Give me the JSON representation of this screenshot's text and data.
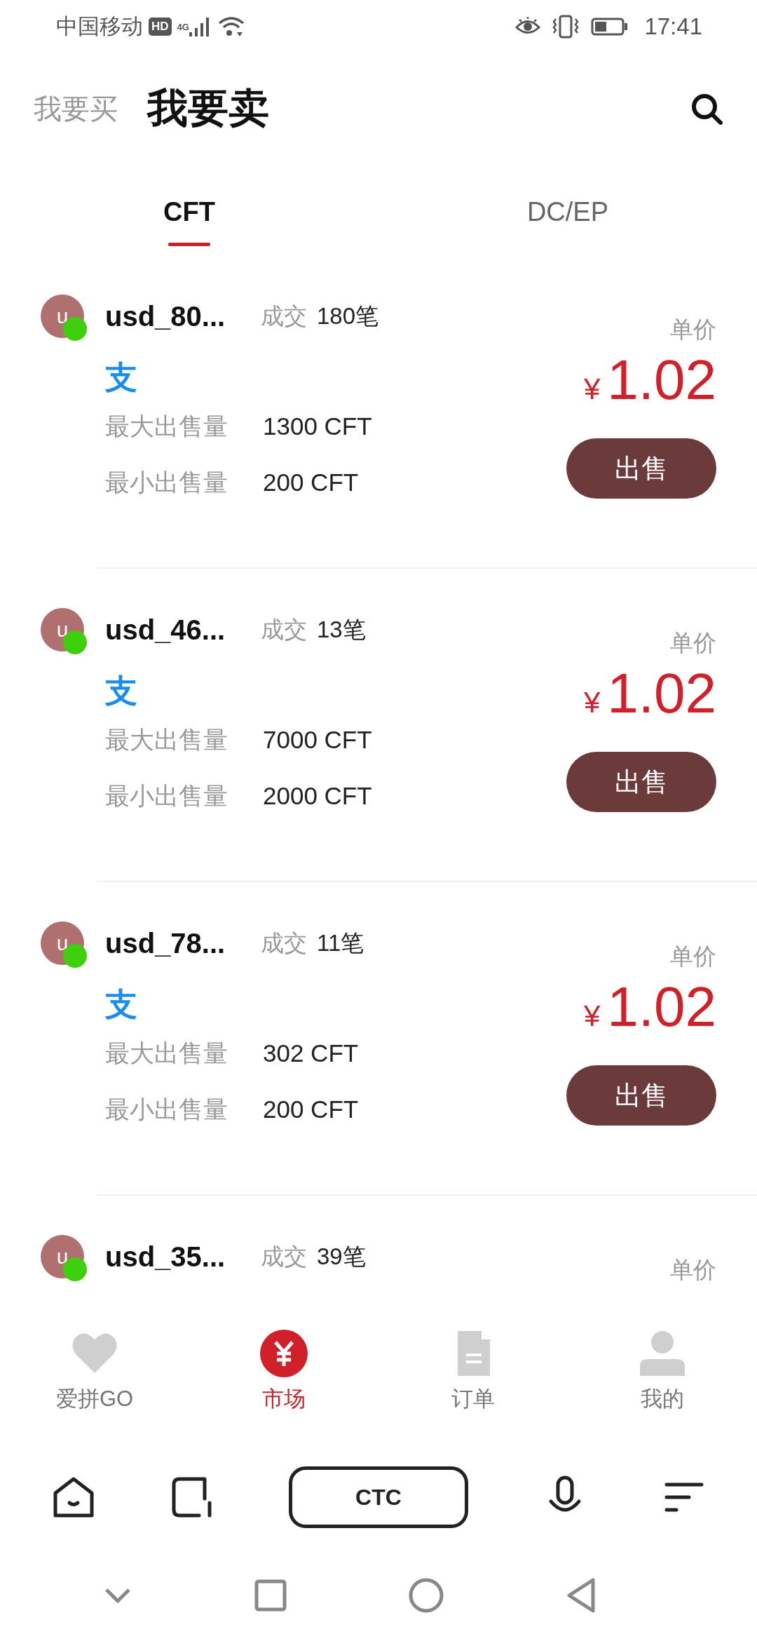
{
  "status_bar": {
    "carrier": "中国移动",
    "hd": "HD",
    "network": "4G",
    "time": "17:41"
  },
  "header": {
    "tabs": [
      {
        "label": "我要买",
        "selected": false
      },
      {
        "label": "我要卖",
        "selected": true
      }
    ]
  },
  "coin_tabs": [
    {
      "label": "CFT",
      "selected": true
    },
    {
      "label": "DC/EP",
      "selected": false
    }
  ],
  "offers": [
    {
      "avatar": "u",
      "online": true,
      "name": "usd_80...",
      "trades_label": "成交",
      "trades": "180笔",
      "pay_icon": "支",
      "price_label": "单价",
      "currency": "¥",
      "price": "1.02",
      "max_label": "最大出售量",
      "max": "1300 CFT",
      "min_label": "最小出售量",
      "min": "200 CFT",
      "button": "出售"
    },
    {
      "avatar": "u",
      "online": true,
      "name": "usd_46...",
      "trades_label": "成交",
      "trades": "13笔",
      "pay_icon": "支",
      "price_label": "单价",
      "currency": "¥",
      "price": "1.02",
      "max_label": "最大出售量",
      "max": "7000 CFT",
      "min_label": "最小出售量",
      "min": "2000 CFT",
      "button": "出售"
    },
    {
      "avatar": "u",
      "online": true,
      "name": "usd_78...",
      "trades_label": "成交",
      "trades": "11笔",
      "pay_icon": "支",
      "price_label": "单价",
      "currency": "¥",
      "price": "1.02",
      "max_label": "最大出售量",
      "max": "302 CFT",
      "min_label": "最小出售量",
      "min": "200 CFT",
      "button": "出售"
    },
    {
      "avatar": "u",
      "online": true,
      "name": "usd_35...",
      "trades_label": "成交",
      "trades": "39笔",
      "price_label": "单价"
    }
  ],
  "bottom_nav": [
    {
      "kind": "heart",
      "label": "爱拼GO",
      "selected": false
    },
    {
      "kind": "yen",
      "label": "市场",
      "selected": true
    },
    {
      "kind": "document",
      "label": "订单",
      "selected": false
    },
    {
      "kind": "person",
      "label": "我的",
      "selected": false
    }
  ],
  "browser_toolbar": {
    "center": "CTC"
  }
}
